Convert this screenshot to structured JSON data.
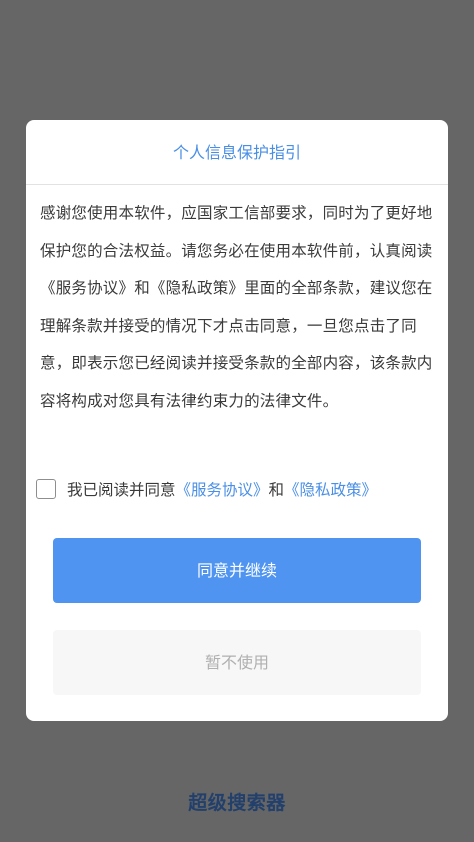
{
  "app": {
    "name": "超级搜索器"
  },
  "dialog": {
    "title": "个人信息保护指引",
    "body": "感谢您使用本软件，应国家工信部要求，同时为了更好地保护您的合法权益。请您务必在使用本软件前，认真阅读《服务协议》和《隐私政策》里面的全部条款，建议您在理解条款并接受的情况下才点击同意，一旦您点击了同意，即表示您已经阅读并接受条款的全部内容，该条款内容将构成对您具有法律约束力的法律文件。",
    "agreement": {
      "checked": false,
      "prefix": "我已阅读并同意",
      "service_link": "《服务协议》",
      "conjunction": "和",
      "privacy_link": "《隐私政策》"
    },
    "agree_button": "同意并继续",
    "decline_button": "暂不使用"
  },
  "colors": {
    "backdrop": "#666666",
    "accent": "#4e94f0",
    "link": "#4a8fe6",
    "app_name": "#22406b"
  }
}
